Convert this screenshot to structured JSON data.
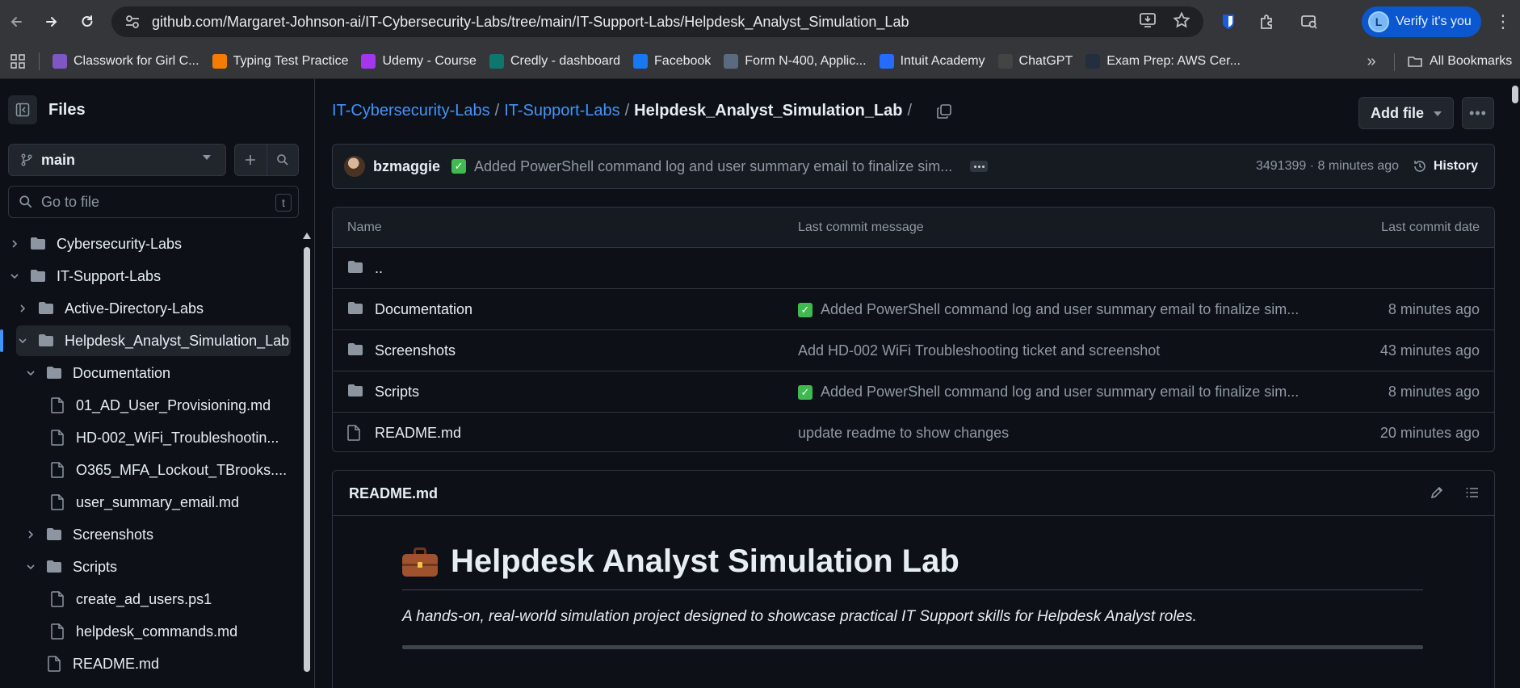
{
  "browser": {
    "url": "github.com/Margaret-Johnson-ai/IT-Cybersecurity-Labs/tree/main/IT-Support-Labs/Helpdesk_Analyst_Simulation_Lab",
    "profile_initial": "L",
    "profile_label": "Verify it's you"
  },
  "bookmarks": {
    "items": [
      {
        "label": "Classwork for Girl C...",
        "icon": "google-classroom-icon",
        "color": "#7e57c2"
      },
      {
        "label": "Typing Test Practice",
        "icon": "typing-test-icon",
        "color": "#f57c00"
      },
      {
        "label": "Udemy - Course",
        "icon": "udemy-icon",
        "color": "#a435f0"
      },
      {
        "label": "Credly - dashboard",
        "icon": "credly-icon",
        "color": "#0f766e"
      },
      {
        "label": "Facebook",
        "icon": "facebook-icon",
        "color": "#1877f2"
      },
      {
        "label": "Form N-400, Applic...",
        "icon": "uscis-icon",
        "color": "#5b6b7f"
      },
      {
        "label": "Intuit Academy",
        "icon": "intuit-icon",
        "color": "#236cff"
      },
      {
        "label": "ChatGPT",
        "icon": "chatgpt-icon",
        "color": "#444444"
      },
      {
        "label": "Exam Prep: AWS Cer...",
        "icon": "aws-icon",
        "color": "#232f3e"
      }
    ],
    "all_label": "All Bookmarks"
  },
  "sidebar": {
    "title": "Files",
    "branch": "main",
    "goto_placeholder": "Go to file",
    "goto_shortcut": "t",
    "tree": [
      {
        "label": "Cybersecurity-Labs",
        "type": "folder",
        "level": 0,
        "expanded": false
      },
      {
        "label": "IT-Support-Labs",
        "type": "folder",
        "level": 0,
        "expanded": true
      },
      {
        "label": "Active-Directory-Labs",
        "type": "folder",
        "level": 1,
        "expanded": false
      },
      {
        "label": "Helpdesk_Analyst_Simulation_Lab",
        "type": "folder",
        "level": 1,
        "expanded": true,
        "selected": true
      },
      {
        "label": "Documentation",
        "type": "folder",
        "level": 2,
        "expanded": true
      },
      {
        "label": "01_AD_User_Provisioning.md",
        "type": "file",
        "level": 3
      },
      {
        "label": "HD-002_WiFi_Troubleshootin...",
        "type": "file",
        "level": 3
      },
      {
        "label": "O365_MFA_Lockout_TBrooks....",
        "type": "file",
        "level": 3
      },
      {
        "label": "user_summary_email.md",
        "type": "file",
        "level": 3
      },
      {
        "label": "Screenshots",
        "type": "folder",
        "level": 2,
        "expanded": false
      },
      {
        "label": "Scripts",
        "type": "folder",
        "level": 2,
        "expanded": true
      },
      {
        "label": "create_ad_users.ps1",
        "type": "file",
        "level": 3
      },
      {
        "label": "helpdesk_commands.md",
        "type": "file",
        "level": 3
      },
      {
        "label": "README.md",
        "type": "file",
        "level": 2
      }
    ]
  },
  "breadcrumb": {
    "parts": [
      "IT-Cybersecurity-Labs",
      "IT-Support-Labs"
    ],
    "current": "Helpdesk_Analyst_Simulation_Lab",
    "trailing_sep": "/"
  },
  "actions": {
    "add_file": "Add file"
  },
  "latest_commit": {
    "user": "bzmaggie",
    "message": "Added PowerShell command log and user summary email to finalize sim...",
    "meta": "3491399 · 8 minutes ago",
    "history_label": "History"
  },
  "file_table": {
    "headers": {
      "name": "Name",
      "message": "Last commit message",
      "date": "Last commit date"
    },
    "parent": "..",
    "rows": [
      {
        "name": "Documentation",
        "type": "folder",
        "check": true,
        "message": "Added PowerShell command log and user summary email to finalize sim...",
        "date": "8 minutes ago"
      },
      {
        "name": "Screenshots",
        "type": "folder",
        "check": false,
        "message": "Add HD-002 WiFi Troubleshooting ticket and screenshot",
        "date": "43 minutes ago"
      },
      {
        "name": "Scripts",
        "type": "folder",
        "check": true,
        "message": "Added PowerShell command log and user summary email to finalize sim...",
        "date": "8 minutes ago"
      },
      {
        "name": "README.md",
        "type": "file",
        "check": false,
        "message": "update readme to show changes",
        "date": "20 minutes ago"
      }
    ]
  },
  "readme": {
    "file_label": "README.md",
    "h1": "Helpdesk Analyst Simulation Lab",
    "h1_emoji": "briefcase-icon",
    "intro": "A hands-on, real-world simulation project designed to showcase practical IT Support skills for Helpdesk Analyst roles."
  }
}
